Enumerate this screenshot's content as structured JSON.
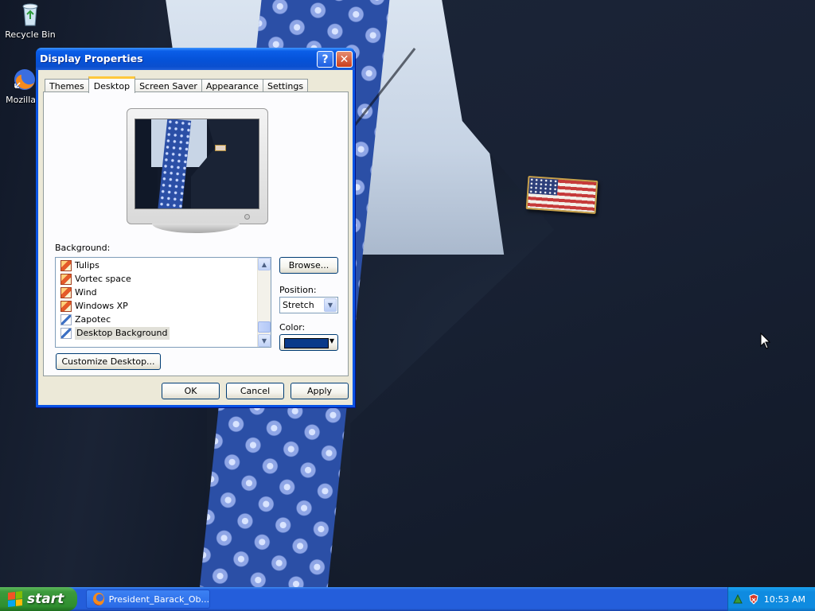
{
  "desktop": {
    "icons": [
      {
        "label": "Recycle Bin",
        "icon": "recycle-bin-icon"
      },
      {
        "label": "Mozilla F",
        "icon": "firefox-icon"
      }
    ]
  },
  "dialog": {
    "title": "Display Properties",
    "help_glyph": "?",
    "close_glyph": "✕",
    "tabs": [
      {
        "label": "Themes",
        "active": false
      },
      {
        "label": "Desktop",
        "active": true
      },
      {
        "label": "Screen Saver",
        "active": false
      },
      {
        "label": "Appearance",
        "active": false
      },
      {
        "label": "Settings",
        "active": false
      }
    ],
    "background_label": "Background:",
    "background_items": [
      {
        "label": "Tulips",
        "icon": "image-file-icon"
      },
      {
        "label": "Vortec space",
        "icon": "image-file-icon"
      },
      {
        "label": "Wind",
        "icon": "image-file-icon"
      },
      {
        "label": "Windows XP",
        "icon": "image-file-icon"
      },
      {
        "label": "Zapotec",
        "icon": "pen-icon"
      },
      {
        "label": "Desktop Background",
        "icon": "pen-icon",
        "selected": true
      }
    ],
    "browse_label": "Browse...",
    "position_label": "Position:",
    "position_value": "Stretch",
    "color_label": "Color:",
    "color_value": "#0a3a8a",
    "customize_label": "Customize Desktop...",
    "ok_label": "OK",
    "cancel_label": "Cancel",
    "apply_label": "Apply"
  },
  "taskbar": {
    "start_label": "start",
    "task_item": "President_Barack_Ob...",
    "clock": "10:53 AM"
  },
  "colors": {
    "titlebar": "#0552d8",
    "taskbar": "#245edb",
    "start": "#3c9a3c",
    "dialog_face": "#ece9d8"
  }
}
